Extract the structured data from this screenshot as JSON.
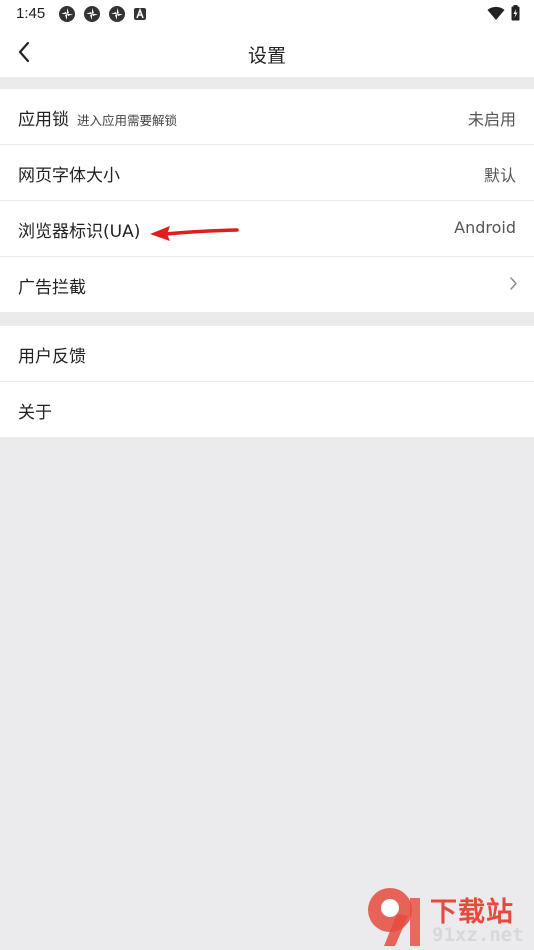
{
  "status_bar": {
    "time": "1:45",
    "left_icons": [
      "notification-icon",
      "notification-icon",
      "notification-icon",
      "a-icon"
    ],
    "right_icons": [
      "wifi-icon",
      "battery-icon"
    ]
  },
  "header": {
    "title": "设置",
    "back_icon": "chevron-left-icon"
  },
  "groups": [
    {
      "items": [
        {
          "label": "应用锁",
          "sublabel": "进入应用需要解锁",
          "value": "未启用"
        },
        {
          "label": "网页字体大小",
          "value": "默认"
        },
        {
          "label": "浏览器标识(UA)",
          "value": "Android"
        },
        {
          "label": "广告拦截",
          "icon": "chevron-right-icon"
        }
      ]
    },
    {
      "items": [
        {
          "label": "用户反馈"
        },
        {
          "label": "关于"
        }
      ]
    }
  ],
  "annotation": {
    "icon": "red-arrow-icon",
    "color": "#e01e1e"
  },
  "watermark": {
    "text": "下载站",
    "domain": "91xz.net",
    "color": "#e64a3c"
  },
  "colors": {
    "background": "#ebebed",
    "surface": "#ffffff"
  }
}
